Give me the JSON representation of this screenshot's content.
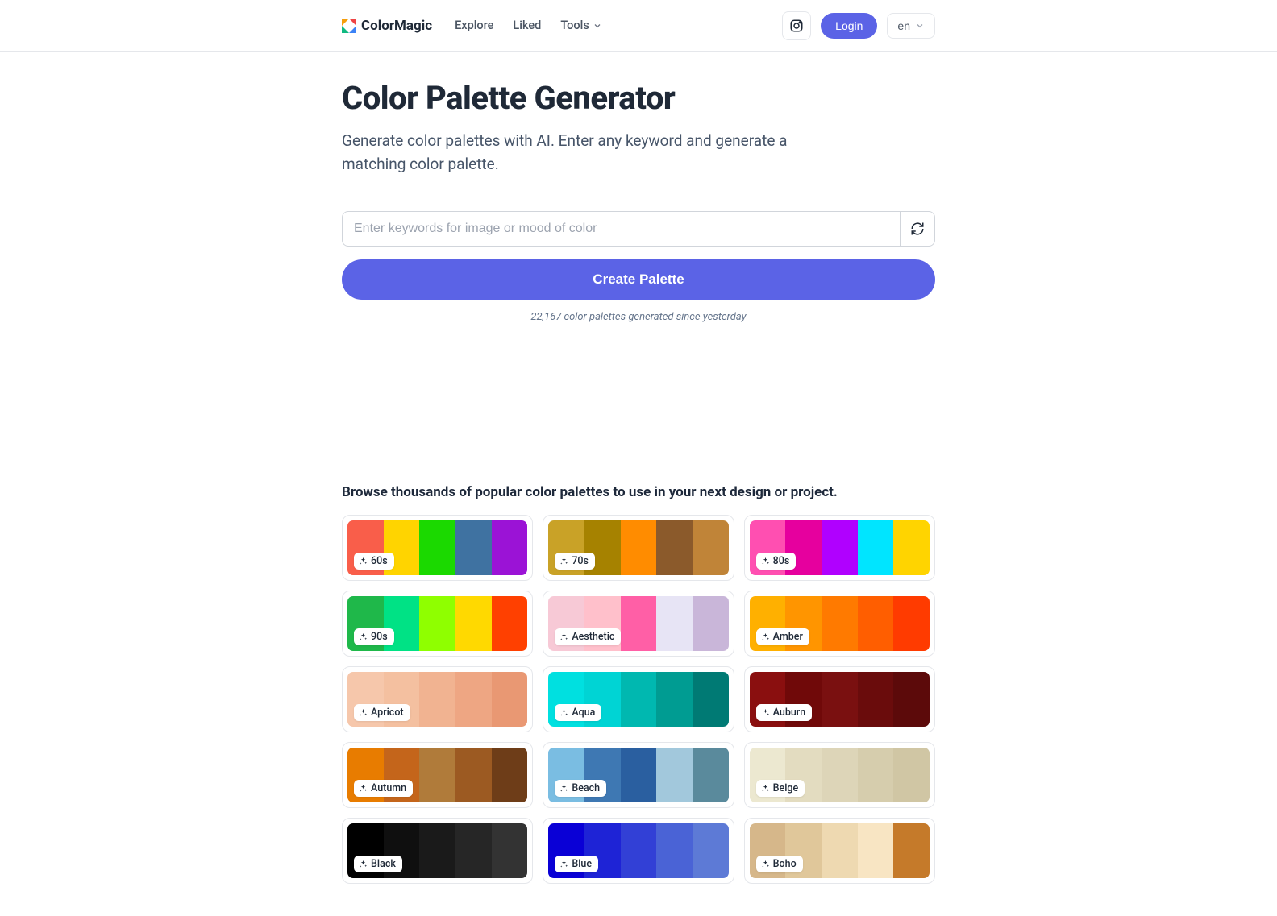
{
  "header": {
    "brand": "ColorMagic",
    "nav": {
      "explore": "Explore",
      "liked": "Liked",
      "tools": "Tools"
    },
    "login": "Login",
    "lang": "en"
  },
  "main": {
    "title": "Color Palette Generator",
    "subtitle": "Generate color palettes with AI. Enter any keyword and generate a matching color palette.",
    "placeholder": "Enter keywords for image or mood of color",
    "create": "Create Palette",
    "stats": "22,167 color palettes generated since yesterday"
  },
  "browse": {
    "heading": "Browse thousands of popular color palettes to use in your next design or project.",
    "cards": [
      {
        "label": "60s",
        "colors": [
          "#f95e4a",
          "#ffd400",
          "#1bd900",
          "#3f72a1",
          "#9b13d6"
        ]
      },
      {
        "label": "70s",
        "colors": [
          "#c9a227",
          "#a68200",
          "#ff8c00",
          "#8b5a2b",
          "#c08438"
        ]
      },
      {
        "label": "80s",
        "colors": [
          "#ff4fb1",
          "#e6009e",
          "#b000ff",
          "#00e5ff",
          "#ffd400"
        ]
      },
      {
        "label": "90s",
        "colors": [
          "#1fb84a",
          "#00e285",
          "#8fff00",
          "#ffd900",
          "#ff4000"
        ]
      },
      {
        "label": "Aesthetic",
        "colors": [
          "#f7c9d6",
          "#ffc0cb",
          "#ff5fa6",
          "#e7e4f5",
          "#c9b6d9"
        ]
      },
      {
        "label": "Amber",
        "colors": [
          "#ffb000",
          "#ff9500",
          "#ff7a00",
          "#ff5e00",
          "#ff3b00"
        ]
      },
      {
        "label": "Apricot",
        "colors": [
          "#f6c7ab",
          "#f4c0a0",
          "#f1b391",
          "#eea683",
          "#e99873"
        ]
      },
      {
        "label": "Aqua",
        "colors": [
          "#00e0e0",
          "#00d4d4",
          "#00b8b0",
          "#009c92",
          "#007a74"
        ]
      },
      {
        "label": "Auburn",
        "colors": [
          "#8a0f0f",
          "#700909",
          "#7a1010",
          "#6a0c0c",
          "#5c0a0a"
        ]
      },
      {
        "label": "Autumn",
        "colors": [
          "#e87c00",
          "#c4651b",
          "#b07b3a",
          "#9c5a22",
          "#6e3d18"
        ]
      },
      {
        "label": "Beach",
        "colors": [
          "#7abde2",
          "#3e78b3",
          "#2a5fa0",
          "#a2c8dc",
          "#5a8a9c"
        ]
      },
      {
        "label": "Beige",
        "colors": [
          "#ece8d0",
          "#e3dcc0",
          "#ddd5b8",
          "#d6cdad",
          "#d0c6a4"
        ]
      },
      {
        "label": "Black",
        "colors": [
          "#000000",
          "#0f0f0f",
          "#1a1a1a",
          "#262626",
          "#333333"
        ]
      },
      {
        "label": "Blue",
        "colors": [
          "#0a00d6",
          "#1e23d6",
          "#3240d6",
          "#4a63d6",
          "#5d7ad6"
        ]
      },
      {
        "label": "Boho",
        "colors": [
          "#d6b78a",
          "#e0c79a",
          "#eed9b1",
          "#f8e5c3",
          "#c57a2a"
        ]
      }
    ]
  }
}
